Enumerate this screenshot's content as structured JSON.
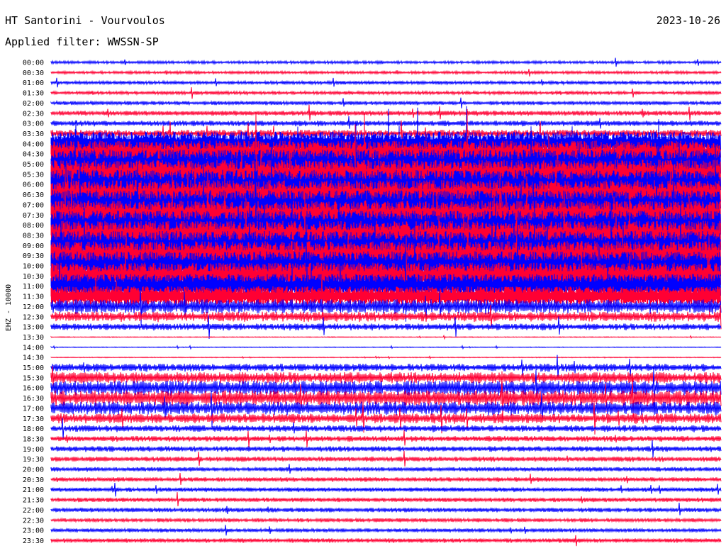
{
  "header": {
    "station": "HT Santorini - Vourvoulos",
    "date": "2023-10-26",
    "filter": "Applied filter: WWSSN-SP"
  },
  "side_label": "EHZ - 10000",
  "chart_data": {
    "type": "line",
    "title": "HT Santorini - Vourvoulos",
    "ylabel": "EHZ - 10000",
    "xlabel": "",
    "colors": [
      "#0000ff",
      "#ff0033"
    ],
    "rows": [
      {
        "label": "00:00",
        "amp": 0.25
      },
      {
        "label": "00:30",
        "amp": 0.25
      },
      {
        "label": "01:00",
        "amp": 0.3
      },
      {
        "label": "01:30",
        "amp": 0.3
      },
      {
        "label": "02:00",
        "amp": 0.35
      },
      {
        "label": "02:30",
        "amp": 0.45
      },
      {
        "label": "03:00",
        "amp": 0.5
      },
      {
        "label": "03:30",
        "amp": 0.7
      },
      {
        "label": "04:00",
        "amp": 2.2
      },
      {
        "label": "04:30",
        "amp": 2.4
      },
      {
        "label": "05:00",
        "amp": 2.6
      },
      {
        "label": "05:30",
        "amp": 2.6
      },
      {
        "label": "06:00",
        "amp": 2.6
      },
      {
        "label": "06:30",
        "amp": 2.6
      },
      {
        "label": "07:00",
        "amp": 2.6
      },
      {
        "label": "07:30",
        "amp": 2.6
      },
      {
        "label": "08:00",
        "amp": 2.6
      },
      {
        "label": "08:30",
        "amp": 2.6
      },
      {
        "label": "09:00",
        "amp": 2.6
      },
      {
        "label": "09:30",
        "amp": 2.6
      },
      {
        "label": "10:00",
        "amp": 2.6
      },
      {
        "label": "10:30",
        "amp": 2.4
      },
      {
        "label": "11:00",
        "amp": 2.2
      },
      {
        "label": "11:30",
        "amp": 1.8
      },
      {
        "label": "12:00",
        "amp": 1.3
      },
      {
        "label": "12:30",
        "amp": 0.9
      },
      {
        "label": "13:00",
        "amp": 0.6
      },
      {
        "label": "13:30",
        "amp": 0.05
      },
      {
        "label": "14:00",
        "amp": 0.05
      },
      {
        "label": "14:30",
        "amp": 0.05
      },
      {
        "label": "15:00",
        "amp": 0.7
      },
      {
        "label": "15:30",
        "amp": 1.0
      },
      {
        "label": "16:00",
        "amp": 1.3
      },
      {
        "label": "16:30",
        "amp": 1.4
      },
      {
        "label": "17:00",
        "amp": 1.2
      },
      {
        "label": "17:30",
        "amp": 0.9
      },
      {
        "label": "18:00",
        "amp": 0.6
      },
      {
        "label": "18:30",
        "amp": 0.5
      },
      {
        "label": "19:00",
        "amp": 0.5
      },
      {
        "label": "19:30",
        "amp": 0.45
      },
      {
        "label": "20:00",
        "amp": 0.4
      },
      {
        "label": "20:30",
        "amp": 0.4
      },
      {
        "label": "21:00",
        "amp": 0.4
      },
      {
        "label": "21:30",
        "amp": 0.4
      },
      {
        "label": "22:00",
        "amp": 0.4
      },
      {
        "label": "22:30",
        "amp": 0.35
      },
      {
        "label": "23:00",
        "amp": 0.35
      },
      {
        "label": "23:30",
        "amp": 0.4
      }
    ]
  }
}
